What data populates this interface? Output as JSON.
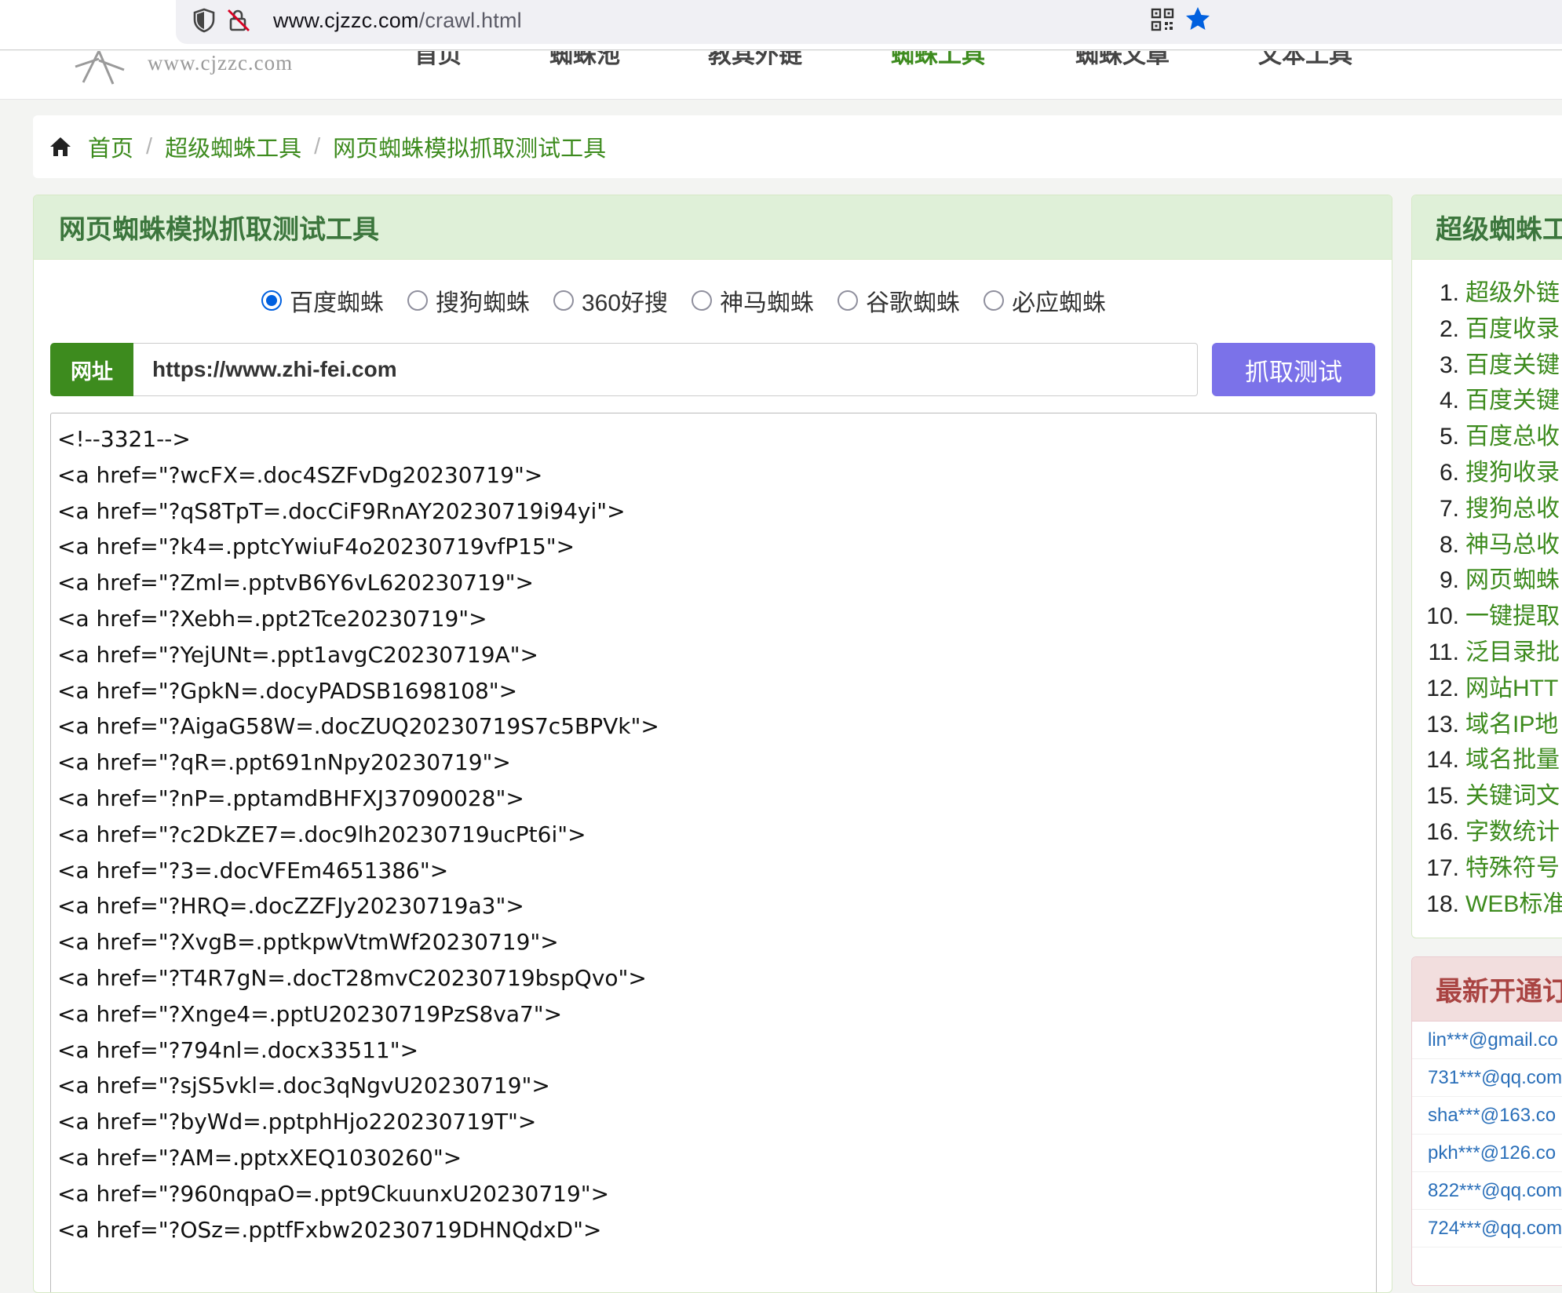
{
  "browser": {
    "url_host": "www.cjzzc.com",
    "url_path": "/crawl.html"
  },
  "site_header": {
    "logo_text": "www.cjzzc.com",
    "nav": [
      "首页",
      "蜘蛛池",
      "教其外链",
      "蜘蛛工具",
      "蜘蛛文章",
      "文本工具"
    ],
    "active_index": 3
  },
  "breadcrumb": {
    "items": [
      "首页",
      "超级蜘蛛工具",
      "网页蜘蛛模拟抓取测试工具"
    ]
  },
  "main": {
    "title": "网页蜘蛛模拟抓取测试工具",
    "radios": [
      {
        "label": "百度蜘蛛",
        "checked": true
      },
      {
        "label": "搜狗蜘蛛",
        "checked": false
      },
      {
        "label": "360好搜",
        "checked": false
      },
      {
        "label": "神马蜘蛛",
        "checked": false
      },
      {
        "label": "谷歌蜘蛛",
        "checked": false
      },
      {
        "label": "必应蜘蛛",
        "checked": false
      }
    ],
    "url_label": "网址",
    "url_value": "https://www.zhi-fei.com",
    "submit_label": "抓取测试",
    "result_lines": [
      "<!--3321-->",
      "<a href=\"?wcFX=.doc4SZFvDg20230719\">",
      "<a href=\"?qS8TpT=.docCiF9RnAY20230719i94yi\">",
      "<a href=\"?k4=.pptcYwiuF4o20230719vfP15\">",
      "<a href=\"?Zml=.pptvB6Y6vL620230719\">",
      "<a href=\"?Xebh=.ppt2Tce20230719\">",
      "<a href=\"?YejUNt=.ppt1avgC20230719A\">",
      "<a href=\"?GpkN=.docyPADSB1698108\">",
      "<a href=\"?AigaG58W=.docZUQ20230719S7c5BPVk\">",
      "<a href=\"?qR=.ppt691nNpy20230719\">",
      "<a href=\"?nP=.pptamdBHFXJ37090028\">",
      "<a href=\"?c2DkZE7=.doc9lh20230719ucPt6i\">",
      "<a href=\"?3=.docVFEm4651386\">",
      "<a href=\"?HRQ=.docZZFJy20230719a3\">",
      "<a href=\"?XvgB=.pptkpwVtmWf20230719\">",
      "<a href=\"?T4R7gN=.docT28mvC20230719bspQvo\">",
      "<a href=\"?Xnge4=.pptU20230719PzS8va7\">",
      "<a href=\"?794nl=.docx33511\">",
      "<a href=\"?sjS5vkl=.doc3qNgvU20230719\">",
      "<a href=\"?byWd=.pptphHjo220230719T\">",
      "<a href=\"?AM=.pptxXEQ1030260\">",
      "<a href=\"?960nqpaO=.ppt9CkuunxU20230719\">",
      "<a href=\"?OSz=.pptfFxbw20230719DHNQdxD\">"
    ]
  },
  "sidebar": {
    "title": "超级蜘蛛工",
    "items": [
      {
        "num": "1.",
        "label": "超级外链"
      },
      {
        "num": "2.",
        "label": "百度收录"
      },
      {
        "num": "3.",
        "label": "百度关键"
      },
      {
        "num": "4.",
        "label": "百度关键"
      },
      {
        "num": "5.",
        "label": "百度总收"
      },
      {
        "num": "6.",
        "label": "搜狗收录"
      },
      {
        "num": "7.",
        "label": "搜狗总收"
      },
      {
        "num": "8.",
        "label": "神马总收"
      },
      {
        "num": "9.",
        "label": "网页蜘蛛"
      },
      {
        "num": "10.",
        "label": "一键提取"
      },
      {
        "num": "11.",
        "label": "泛目录批"
      },
      {
        "num": "12.",
        "label": "网站HTT"
      },
      {
        "num": "13.",
        "label": "域名IP地"
      },
      {
        "num": "14.",
        "label": "域名批量"
      },
      {
        "num": "15.",
        "label": "关键词文"
      },
      {
        "num": "16.",
        "label": "字数统计"
      },
      {
        "num": "17.",
        "label": "特殊符号"
      },
      {
        "num": "18.",
        "label": "WEB标准"
      }
    ]
  },
  "latest": {
    "title": "最新开通订",
    "emails": [
      "lin***@gmail.co",
      "731***@qq.com",
      "sha***@163.co",
      "pkh***@126.co",
      "822***@qq.com",
      "724***@qq.com"
    ]
  },
  "colors": {
    "brand_green": "#3d8b1e",
    "panel_head_bg": "#dff0d8",
    "submit_purple": "#7b72e9",
    "danger_head_bg": "#f2dede"
  }
}
